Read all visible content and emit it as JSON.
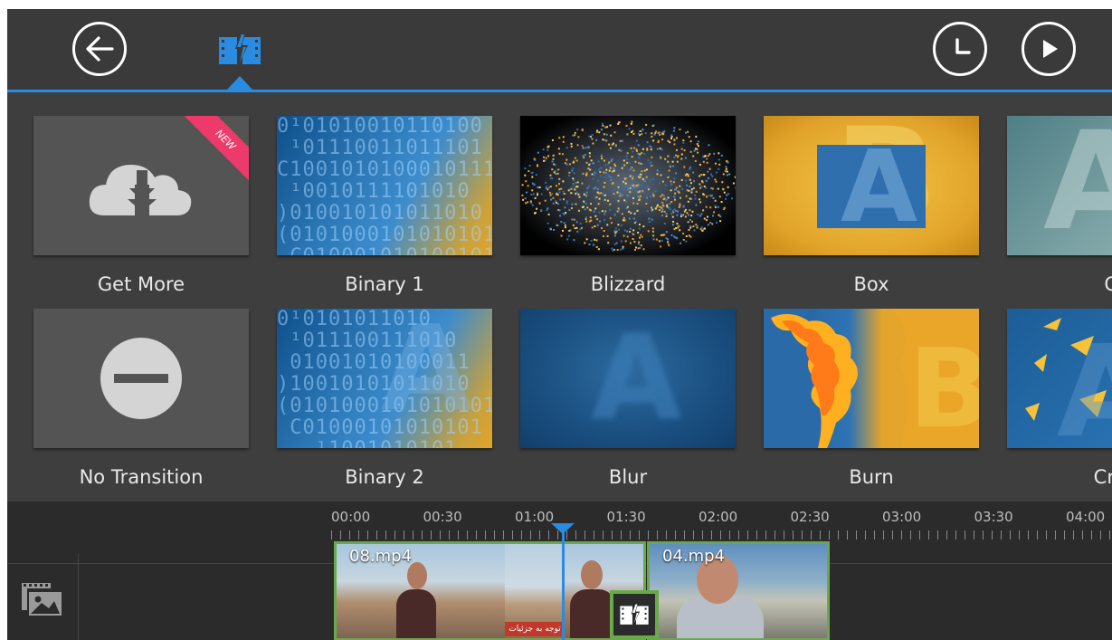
{
  "toolbar": {
    "back_icon": "arrow-left-icon",
    "transition_tab_icon": "transition-icon",
    "duration_icon": "clock-icon",
    "play_icon": "play-icon",
    "accent_color": "#2a8be0"
  },
  "transitions": {
    "row1": [
      {
        "label": "Get More",
        "badge": "NEW",
        "icon": "cloud-download-icon"
      },
      {
        "label": "Binary 1"
      },
      {
        "label": "Blizzard"
      },
      {
        "label": "Box"
      },
      {
        "label": "Cr"
      }
    ],
    "row2": [
      {
        "label": "No Transition",
        "icon": "minus-circle-icon"
      },
      {
        "label": "Binary 2"
      },
      {
        "label": "Blur"
      },
      {
        "label": "Burn"
      },
      {
        "label": "Crys"
      }
    ]
  },
  "timeline": {
    "ruler": [
      "00:00",
      "00:30",
      "01:00",
      "01:30",
      "02:00",
      "02:30",
      "03:00",
      "03:30",
      "04:00"
    ],
    "media_icon": "media-library-icon",
    "clips": [
      {
        "name": "08.mp4",
        "caption": "توجه به جزئیات"
      },
      {
        "name": "04.mp4"
      }
    ],
    "transition_marker_icon": "transition-icon",
    "clip_border_color": "#6aa94a",
    "playhead_color": "#2a8be0"
  }
}
